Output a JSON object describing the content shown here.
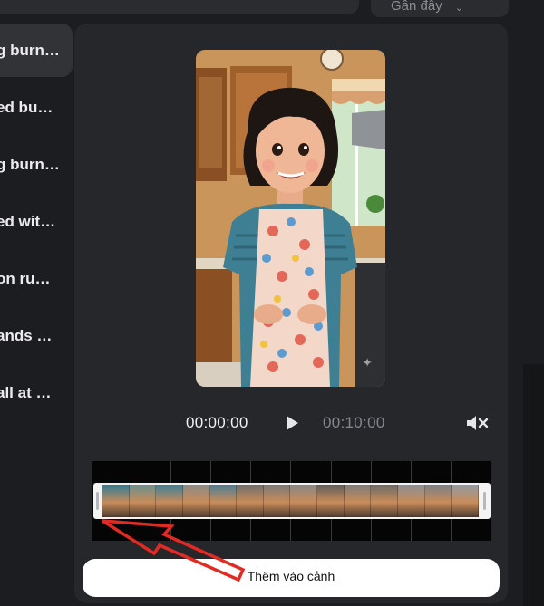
{
  "header": {
    "dropdown_label": "Gần đây",
    "dropdown_icon": "chevron-down-icon"
  },
  "sidebar": {
    "items": [
      {
        "label": "g burn…",
        "active": true
      },
      {
        "label": "ed bu…",
        "active": false
      },
      {
        "label": "g burn…",
        "active": false
      },
      {
        "label": "ed wit…",
        "active": false
      },
      {
        "label": "on ru…",
        "active": false
      },
      {
        "label": "ands …",
        "active": false
      },
      {
        "label": "all at …",
        "active": false
      }
    ]
  },
  "player": {
    "current_time": "00:00:00",
    "total_time": "00:10:00",
    "play_icon": "play-icon",
    "mute_icon": "volume-mute-icon",
    "watermark_icon": "sparkle-icon"
  },
  "timeline": {
    "frame_colors": [
      "#2f7b95",
      "#6a8f8d",
      "#3a7f98",
      "#8c8a86",
      "#4b7d92",
      "#6f6d6a",
      "#7a7876",
      "#8a8784",
      "#5f5d5a",
      "#7d7b78",
      "#6c6a67",
      "#8b8f94",
      "#7a7f86",
      "#939ba3"
    ]
  },
  "actions": {
    "add_to_scene_label": "Thêm vào cảnh"
  },
  "colors": {
    "panel_bg": "#26272b",
    "page_bg": "#1c1d20",
    "annotation": "#e02a22"
  }
}
